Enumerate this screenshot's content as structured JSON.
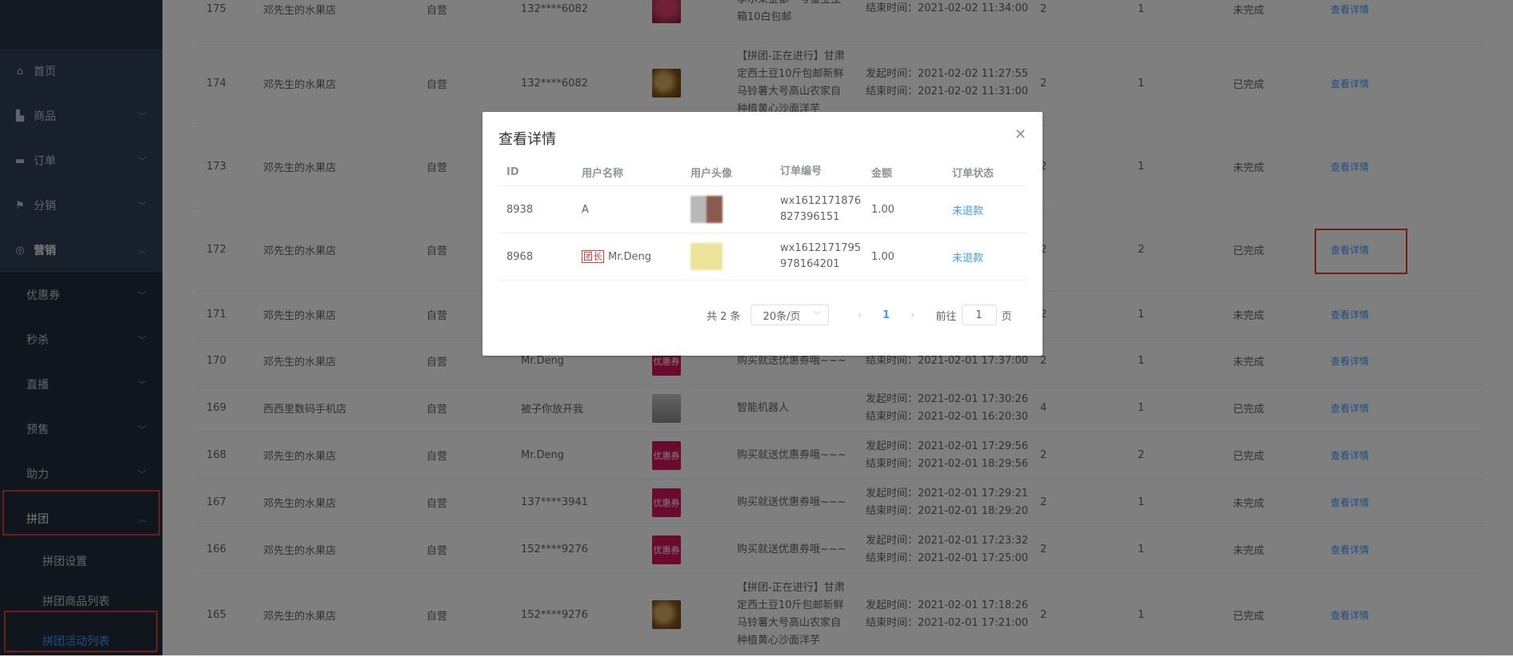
{
  "sidebar": {
    "items": [
      {
        "label": "首页",
        "icon": "home-icon"
      },
      {
        "label": "商品",
        "icon": "bag-icon"
      },
      {
        "label": "订单",
        "icon": "briefcase-icon"
      },
      {
        "label": "分销",
        "icon": "flag-icon"
      },
      {
        "label": "营销",
        "icon": "target-icon"
      }
    ],
    "sub_items": [
      "优惠券",
      "秒杀",
      "直播",
      "预售",
      "助力",
      "拼团"
    ],
    "group_items": [
      "拼团设置",
      "拼团商品列表",
      "拼团活动列表"
    ]
  },
  "table": {
    "rows": [
      {
        "id": "175",
        "shop": "邓先生的水果店",
        "type": "自营",
        "user": "132****6082",
        "thumb": "fruit-top",
        "title": [
          "季水果金都一号蜜宝整",
          "箱10白包邮"
        ],
        "start": "",
        "end": "结束时间：2021-02-02 11:34:00",
        "n1": "2",
        "n2": "1",
        "status": "未完成",
        "link": "查看详情"
      },
      {
        "id": "174",
        "shop": "邓先生的水果店",
        "type": "自营",
        "user": "132****6082",
        "thumb": "fruit",
        "title": [
          "【拼团-正在进行】甘肃",
          "定西土豆10斤包邮新鲜",
          "马铃薯大号高山农家自",
          "种植黄心沙面洋芋"
        ],
        "start": "发起时间：2021-02-02 11:27:55",
        "end": "结束时间：2021-02-02 11:31:00",
        "n1": "2",
        "n2": "1",
        "status": "已完成",
        "link": "查看详情"
      },
      {
        "id": "173",
        "shop": "邓先生的水果店",
        "type": "自营",
        "user": "",
        "thumb": "",
        "title": [],
        "start": "",
        "end": "",
        "n1": "2",
        "n2": "1",
        "status": "未完成",
        "link": "查看详情"
      },
      {
        "id": "172",
        "shop": "邓先生的水果店",
        "type": "自营",
        "user": "",
        "thumb": "",
        "title": [],
        "start": "",
        "end": "",
        "n1": "2",
        "n2": "2",
        "status": "已完成",
        "link": "查看详情"
      },
      {
        "id": "171",
        "shop": "邓先生的水果店",
        "type": "自营",
        "user": "",
        "thumb": "",
        "title": [],
        "start": "",
        "end": "",
        "n1": "2",
        "n2": "1",
        "status": "未完成",
        "link": "查看详情"
      },
      {
        "id": "170",
        "shop": "邓先生的水果店",
        "type": "自营",
        "user": "Mr.Deng",
        "thumb": "coupon",
        "title": [
          "购买就送优惠券哦~~~"
        ],
        "start": "",
        "end": "结束时间：2021-02-01 17:37:00",
        "n1": "2",
        "n2": "1",
        "status": "未完成",
        "link": "查看详情"
      },
      {
        "id": "169",
        "shop": "西西里数码手机店",
        "type": "自营",
        "user": "被子你放开我",
        "thumb": "robot",
        "title": [
          "智能机器人"
        ],
        "start": "发起时间：2021-02-01 17:30:26",
        "end": "结束时间：2021-02-01 16:20:30",
        "n1": "4",
        "n2": "1",
        "status": "已完成",
        "link": "查看详情"
      },
      {
        "id": "168",
        "shop": "邓先生的水果店",
        "type": "自营",
        "user": "Mr.Deng",
        "thumb": "coupon",
        "title": [
          "购买就送优惠券哦~~~"
        ],
        "start": "发起时间：2021-02-01 17:29:56",
        "end": "结束时间：2021-02-01 18:29:56",
        "n1": "2",
        "n2": "2",
        "status": "已完成",
        "link": "查看详情"
      },
      {
        "id": "167",
        "shop": "邓先生的水果店",
        "type": "自营",
        "user": "137****3941",
        "thumb": "coupon",
        "title": [
          "购买就送优惠券哦~~~"
        ],
        "start": "发起时间：2021-02-01 17:29:21",
        "end": "结束时间：2021-02-01 18:29:20",
        "n1": "2",
        "n2": "1",
        "status": "未完成",
        "link": "查看详情"
      },
      {
        "id": "166",
        "shop": "邓先生的水果店",
        "type": "自营",
        "user": "152****9276",
        "thumb": "coupon",
        "title": [
          "购买就送优惠券哦~~~"
        ],
        "start": "发起时间：2021-02-01 17:23:32",
        "end": "结束时间：2021-02-01 17:25:00",
        "n1": "2",
        "n2": "1",
        "status": "未完成",
        "link": "查看详情"
      },
      {
        "id": "165",
        "shop": "邓先生的水果店",
        "type": "自营",
        "user": "152****9276",
        "thumb": "fruit",
        "title": [
          "【拼团-正在进行】甘肃",
          "定西土豆10斤包邮新鲜",
          "马铃薯大号高山农家自",
          "种植黄心沙面洋芋"
        ],
        "start": "发起时间：2021-02-01 17:18:26",
        "end": "结束时间：2021-02-01 17:21:00",
        "n1": "2",
        "n2": "1",
        "status": "已完成",
        "link": "查看详情"
      }
    ],
    "coupon_text": "优惠券"
  },
  "dialog": {
    "title": "查看详情",
    "columns": [
      "ID",
      "用户名称",
      "用户头像",
      "订单编号",
      "金额",
      "订单状态"
    ],
    "rows": [
      {
        "id": "8938",
        "leader": "",
        "name": "A",
        "order": [
          "wx1612171876",
          "827396151"
        ],
        "amount": "1.00",
        "status": "未退款"
      },
      {
        "id": "8968",
        "leader": "团长",
        "name": "Mr.Deng",
        "order": [
          "wx1612171795",
          "978164201"
        ],
        "amount": "1.00",
        "status": "未退款"
      }
    ],
    "pagination": {
      "total": "共 2 条",
      "page_size": "20条/页",
      "current": "1",
      "goto_prefix": "前往",
      "goto_value": "1",
      "goto_suffix": "页"
    }
  },
  "colors": {
    "accent": "#409eff",
    "sidebar": "#304156",
    "highlight_box": "#e53935",
    "coupon": "#d4145a"
  }
}
